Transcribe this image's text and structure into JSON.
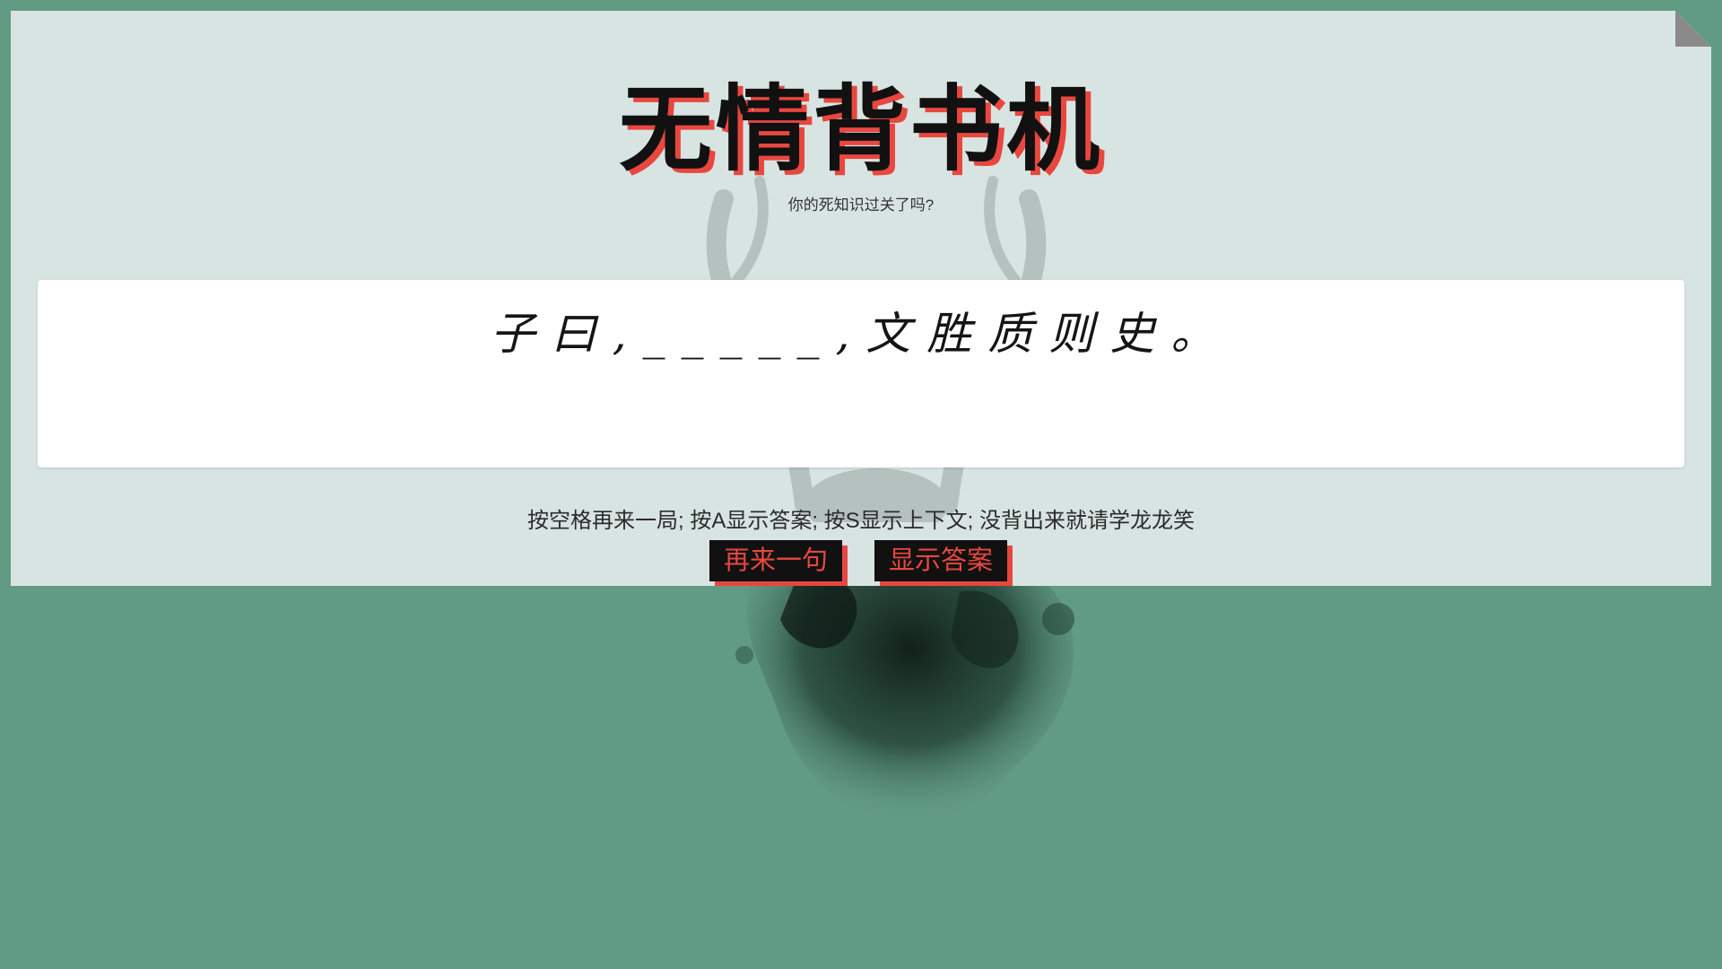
{
  "page": {
    "title": "无情背书机",
    "subtitle": "你的死知识过关了吗?"
  },
  "quote": {
    "text": "子曰,_____,文胜质则史。"
  },
  "hint": {
    "text": "按空格再来一局; 按A显示答案; 按S显示上下文; 没背出来就请学龙龙笑"
  },
  "buttons": {
    "again_label": "再来一句",
    "answer_label": "显示答案"
  },
  "colors": {
    "background": "#629b84",
    "card": "#d8e4e1",
    "accent_red": "#e8473f",
    "button_bg": "#111111",
    "panel": "#ffffff"
  },
  "icons": {
    "corner": "folded-corner-icon",
    "antlers": "deer-antlers-decoration",
    "ink": "ink-blot-decoration"
  }
}
